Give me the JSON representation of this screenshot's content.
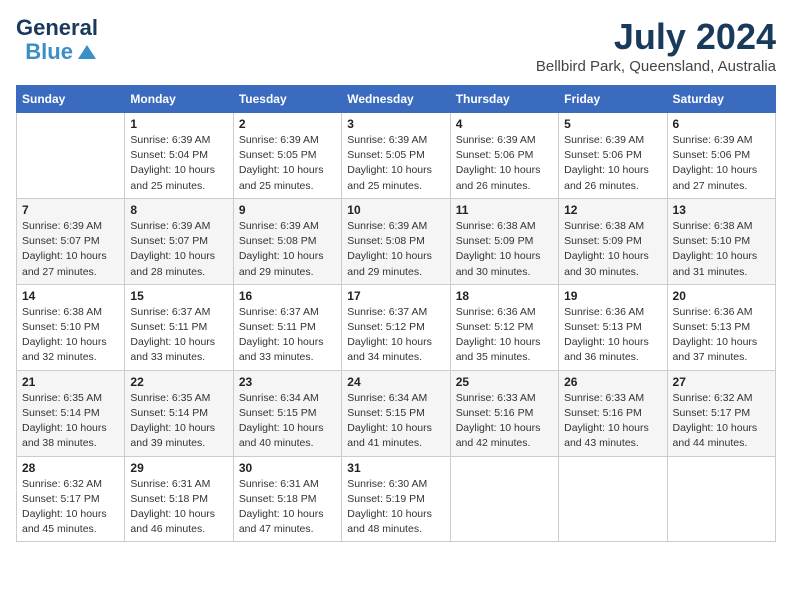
{
  "header": {
    "logo_line1": "General",
    "logo_line2": "Blue",
    "title": "July 2024",
    "subtitle": "Bellbird Park, Queensland, Australia"
  },
  "weekdays": [
    "Sunday",
    "Monday",
    "Tuesday",
    "Wednesday",
    "Thursday",
    "Friday",
    "Saturday"
  ],
  "weeks": [
    [
      {
        "day": "",
        "detail": ""
      },
      {
        "day": "1",
        "detail": "Sunrise: 6:39 AM\nSunset: 5:04 PM\nDaylight: 10 hours\nand 25 minutes."
      },
      {
        "day": "2",
        "detail": "Sunrise: 6:39 AM\nSunset: 5:05 PM\nDaylight: 10 hours\nand 25 minutes."
      },
      {
        "day": "3",
        "detail": "Sunrise: 6:39 AM\nSunset: 5:05 PM\nDaylight: 10 hours\nand 25 minutes."
      },
      {
        "day": "4",
        "detail": "Sunrise: 6:39 AM\nSunset: 5:06 PM\nDaylight: 10 hours\nand 26 minutes."
      },
      {
        "day": "5",
        "detail": "Sunrise: 6:39 AM\nSunset: 5:06 PM\nDaylight: 10 hours\nand 26 minutes."
      },
      {
        "day": "6",
        "detail": "Sunrise: 6:39 AM\nSunset: 5:06 PM\nDaylight: 10 hours\nand 27 minutes."
      }
    ],
    [
      {
        "day": "7",
        "detail": "Sunrise: 6:39 AM\nSunset: 5:07 PM\nDaylight: 10 hours\nand 27 minutes."
      },
      {
        "day": "8",
        "detail": "Sunrise: 6:39 AM\nSunset: 5:07 PM\nDaylight: 10 hours\nand 28 minutes."
      },
      {
        "day": "9",
        "detail": "Sunrise: 6:39 AM\nSunset: 5:08 PM\nDaylight: 10 hours\nand 29 minutes."
      },
      {
        "day": "10",
        "detail": "Sunrise: 6:39 AM\nSunset: 5:08 PM\nDaylight: 10 hours\nand 29 minutes."
      },
      {
        "day": "11",
        "detail": "Sunrise: 6:38 AM\nSunset: 5:09 PM\nDaylight: 10 hours\nand 30 minutes."
      },
      {
        "day": "12",
        "detail": "Sunrise: 6:38 AM\nSunset: 5:09 PM\nDaylight: 10 hours\nand 30 minutes."
      },
      {
        "day": "13",
        "detail": "Sunrise: 6:38 AM\nSunset: 5:10 PM\nDaylight: 10 hours\nand 31 minutes."
      }
    ],
    [
      {
        "day": "14",
        "detail": "Sunrise: 6:38 AM\nSunset: 5:10 PM\nDaylight: 10 hours\nand 32 minutes."
      },
      {
        "day": "15",
        "detail": "Sunrise: 6:37 AM\nSunset: 5:11 PM\nDaylight: 10 hours\nand 33 minutes."
      },
      {
        "day": "16",
        "detail": "Sunrise: 6:37 AM\nSunset: 5:11 PM\nDaylight: 10 hours\nand 33 minutes."
      },
      {
        "day": "17",
        "detail": "Sunrise: 6:37 AM\nSunset: 5:12 PM\nDaylight: 10 hours\nand 34 minutes."
      },
      {
        "day": "18",
        "detail": "Sunrise: 6:36 AM\nSunset: 5:12 PM\nDaylight: 10 hours\nand 35 minutes."
      },
      {
        "day": "19",
        "detail": "Sunrise: 6:36 AM\nSunset: 5:13 PM\nDaylight: 10 hours\nand 36 minutes."
      },
      {
        "day": "20",
        "detail": "Sunrise: 6:36 AM\nSunset: 5:13 PM\nDaylight: 10 hours\nand 37 minutes."
      }
    ],
    [
      {
        "day": "21",
        "detail": "Sunrise: 6:35 AM\nSunset: 5:14 PM\nDaylight: 10 hours\nand 38 minutes."
      },
      {
        "day": "22",
        "detail": "Sunrise: 6:35 AM\nSunset: 5:14 PM\nDaylight: 10 hours\nand 39 minutes."
      },
      {
        "day": "23",
        "detail": "Sunrise: 6:34 AM\nSunset: 5:15 PM\nDaylight: 10 hours\nand 40 minutes."
      },
      {
        "day": "24",
        "detail": "Sunrise: 6:34 AM\nSunset: 5:15 PM\nDaylight: 10 hours\nand 41 minutes."
      },
      {
        "day": "25",
        "detail": "Sunrise: 6:33 AM\nSunset: 5:16 PM\nDaylight: 10 hours\nand 42 minutes."
      },
      {
        "day": "26",
        "detail": "Sunrise: 6:33 AM\nSunset: 5:16 PM\nDaylight: 10 hours\nand 43 minutes."
      },
      {
        "day": "27",
        "detail": "Sunrise: 6:32 AM\nSunset: 5:17 PM\nDaylight: 10 hours\nand 44 minutes."
      }
    ],
    [
      {
        "day": "28",
        "detail": "Sunrise: 6:32 AM\nSunset: 5:17 PM\nDaylight: 10 hours\nand 45 minutes."
      },
      {
        "day": "29",
        "detail": "Sunrise: 6:31 AM\nSunset: 5:18 PM\nDaylight: 10 hours\nand 46 minutes."
      },
      {
        "day": "30",
        "detail": "Sunrise: 6:31 AM\nSunset: 5:18 PM\nDaylight: 10 hours\nand 47 minutes."
      },
      {
        "day": "31",
        "detail": "Sunrise: 6:30 AM\nSunset: 5:19 PM\nDaylight: 10 hours\nand 48 minutes."
      },
      {
        "day": "",
        "detail": ""
      },
      {
        "day": "",
        "detail": ""
      },
      {
        "day": "",
        "detail": ""
      }
    ]
  ]
}
